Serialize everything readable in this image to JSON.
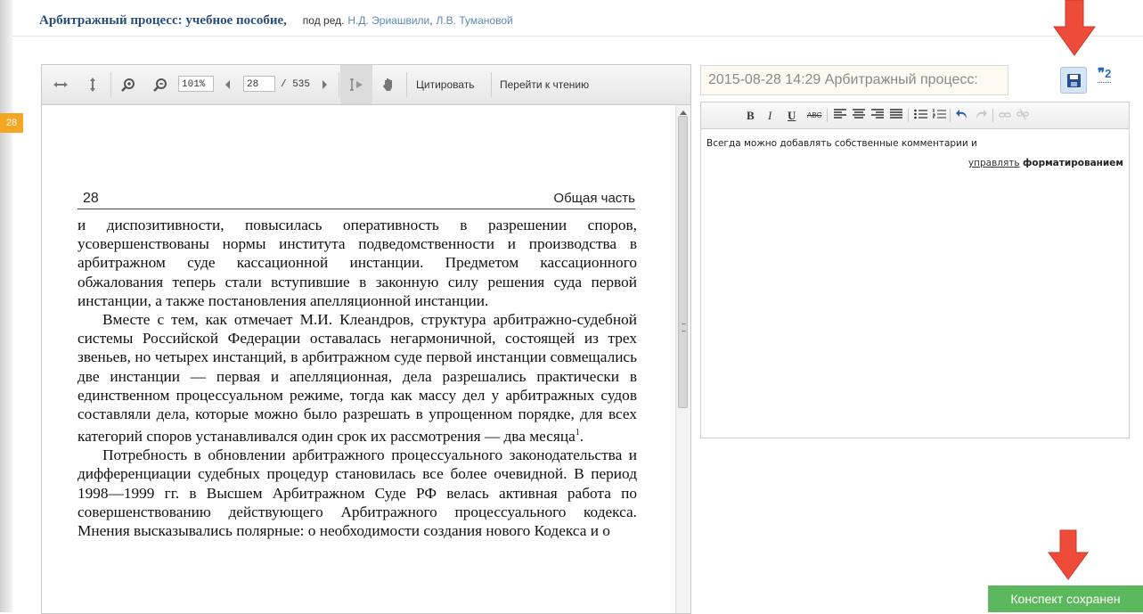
{
  "header": {
    "book_title": "Арбитражный процесс: учебное пособие,",
    "editors_prefix": "под ред.",
    "editor_1": "Н.Д. Эриашвили",
    "editor_separator": ",",
    "editor_2": "Л.В. Тумановой"
  },
  "page_badge": "28",
  "viewer": {
    "zoom_value": "101%",
    "page_value": "28",
    "page_total": "/ 535",
    "cite_button": "Цитировать",
    "goto_reading_button": "Перейти к чтению",
    "icons": [
      "fit-width-icon",
      "fit-height-icon",
      "zoom-in-icon",
      "zoom-out-icon",
      "prev-page-icon",
      "next-page-icon",
      "text-select-icon",
      "hand-tool-icon"
    ]
  },
  "document": {
    "page_number": "28",
    "section": "Общая часть",
    "para_1": "и диспозитивности, повысилась оперативность в разрешении споров, усовершенствованы нормы института подведомственности и производства в арбитражном суде кассационной инстанции. Предметом кассационного обжалования теперь стали вступившие в законную силу решения суда первой инстанции, а также постановления апелляционной инстанции.",
    "para_2": "Вместе с тем, как отмечает М.И. Клеандров, структура арбитражно-судебной системы Российской Федерации оставалась негармоничной, состоящей из трех звеньев, но четырех инстанций, в арбитражном суде первой инстанции совмещались две инстанции — первая и апелляционная, дела разрешались практически в единственном процессуальном режиме, тогда как массу дел у арбитражных судов составляли дела, которые можно было разрешать в упрощенном порядке, для всех категорий споров устанавливался один срок их рассмотрения — два месяца",
    "para_2_footnote": "1",
    "para_2_end": ".",
    "para_3": "Потребность в обновлении арбитражного процессуального законодательства и дифференциации судебных процедур становилась все более очевидной. В период 1998—1999 гг. в Высшем Арбитражном Суде РФ велась активная работа по совершенствованию действующего Арбитражного процессуального кодекса. Мнения высказывались полярные: о необходимости создания нового Кодекса и о"
  },
  "notes": {
    "title_value": "2015-08-28 14:29 Арбитражный процесс:",
    "citation_count": "2",
    "editor_tools": {
      "bold": "B",
      "italic": "I",
      "underline": "U",
      "strike": "ABC"
    },
    "body_line_1": "Всегда можно добавлять собственные комментарии и",
    "body_link": "управлять",
    "body_bold": "форматированием"
  },
  "toast": "Конспект сохранен",
  "colors": {
    "arrow": "#ef4b3a",
    "toast_bg": "#5cb85c",
    "badge": "#f5a623",
    "title_link": "#2a4f7a"
  }
}
